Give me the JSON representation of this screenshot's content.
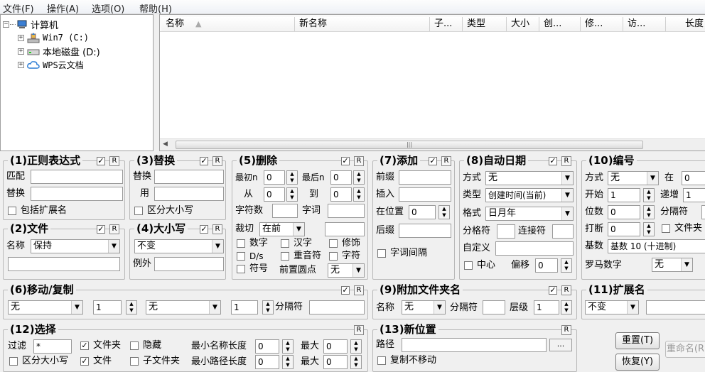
{
  "menu": [
    "文件(F)",
    "操作(A)",
    "选项(O)",
    "帮助(H)"
  ],
  "tree": {
    "root": "计算机",
    "items": [
      "Win7 (C:)",
      "本地磁盘 (D:)",
      "WPS云文档"
    ]
  },
  "list": {
    "columns": [
      "名称",
      "新名称",
      "子...",
      "类型",
      "大小",
      "创...",
      "修...",
      "访...",
      "长度"
    ]
  },
  "regex": {
    "title": "(1)正则表达式",
    "match_label": "匹配",
    "replace_label": "替换",
    "match_value": "",
    "replace_value": "",
    "ext_label": "包括扩展名",
    "checked": true
  },
  "replace": {
    "title": "(3)替换",
    "replace_label": "替换",
    "with_label": "用",
    "case_label": "区分大小写",
    "checked": true
  },
  "file": {
    "title": "(2)文件",
    "name_label": "名称",
    "name_value": "保持",
    "checked": true
  },
  "case": {
    "title": "(4)大小写",
    "value": "不变",
    "except_label": "例外",
    "checked": true
  },
  "delete": {
    "title": "(5)删除",
    "checked": true,
    "first_n_label": "最初n",
    "first_n": "0",
    "last_n_label": "最后n",
    "last_n": "0",
    "from_label": "从",
    "from": "0",
    "to_label": "到",
    "to": "0",
    "chars_label": "字符数",
    "words_label": "字词",
    "crop_label": "裁切",
    "crop_value": "在前",
    "opts": [
      "数字",
      "汉字",
      "修饰",
      "D/s",
      "重音符",
      "字符",
      "符号"
    ],
    "lead_dots_label": "前置圆点",
    "lead_dots_value": "无"
  },
  "add": {
    "title": "(7)添加",
    "checked": true,
    "prefix_label": "前缀",
    "insert_label": "插入",
    "at_pos_label": "在位置",
    "at_pos": "0",
    "suffix_label": "后缀",
    "word_space_label": "字词间隔"
  },
  "autodate": {
    "title": "(8)自动日期",
    "checked": true,
    "mode_label": "方式",
    "mode": "无",
    "type_label": "类型",
    "type": "创建时间(当前)",
    "format_label": "格式",
    "format": "日月年",
    "sep_label": "分格符",
    "conn_label": "连接符",
    "custom_label": "自定义",
    "center_label": "中心",
    "offset_label": "偏移",
    "offset": "0"
  },
  "number": {
    "title": "(10)编号",
    "mode_label": "方式",
    "mode": "无",
    "at_label": "在",
    "at": "0",
    "start_label": "开始",
    "start": "1",
    "incr_label": "递增",
    "incr": "1",
    "digits_label": "位数",
    "digits": "0",
    "sep_label": "分隔符",
    "break_label": "打断",
    "break": "0",
    "folder_label": "文件夹",
    "base_label": "基数",
    "base": "基数 10 (十进制)",
    "roman_label": "罗马数字",
    "roman": "无"
  },
  "move": {
    "title": "(6)移动/复制",
    "checked": true,
    "sel1": "无",
    "num1": "1",
    "sel2": "无",
    "num2": "1",
    "sep_label": "分隔符"
  },
  "append": {
    "title": "(9)附加文件夹名",
    "checked": true,
    "name_label": "名称",
    "name": "无",
    "sep_label": "分隔符",
    "level_label": "层级",
    "level": "1"
  },
  "ext": {
    "title": "(11)扩展名",
    "value": "不变"
  },
  "select": {
    "title": "(12)选择",
    "filter_label": "过滤",
    "filter": "*",
    "folders_label": "文件夹",
    "hidden_label": "隐藏",
    "min_name_label": "最小名称长度",
    "min_name": "0",
    "max_label": "最大",
    "max_name": "0",
    "case_label": "区分大小写",
    "files_label": "文件",
    "subfolders_label": "子文件夹",
    "min_path_label": "最小路径长度",
    "min_path": "0",
    "max_path": "0"
  },
  "newloc": {
    "title": "(13)新位置",
    "path_label": "路径",
    "copy_label": "复制不移动",
    "browse": "..."
  },
  "buttons": {
    "reset": "重置(T)",
    "restore": "恢复(Y)",
    "rename": "重命名(R)"
  },
  "r_label": "R",
  "check_mark": "✓"
}
